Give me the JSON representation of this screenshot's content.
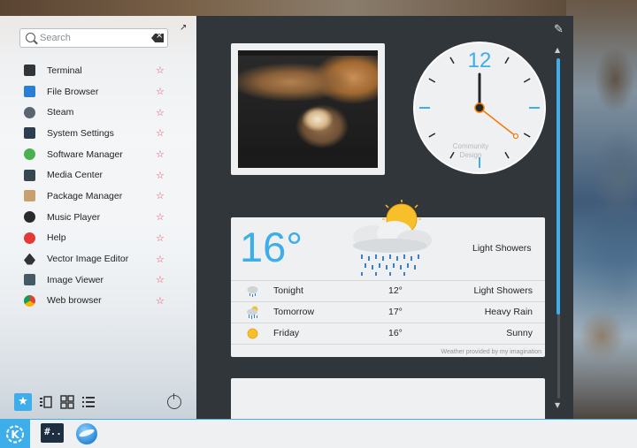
{
  "launcher": {
    "search_placeholder": "Search",
    "apps": [
      {
        "label": "Terminal",
        "icon": "terminal-icon",
        "color": "#31363b"
      },
      {
        "label": "File Browser",
        "icon": "folder-icon",
        "color": "#2a7fd4"
      },
      {
        "label": "Steam",
        "icon": "steam-icon",
        "color": "#5b6570"
      },
      {
        "label": "System Settings",
        "icon": "settings-icon",
        "color": "#2c3e50"
      },
      {
        "label": "Software Manager",
        "icon": "software-icon",
        "color": "#4caf50"
      },
      {
        "label": "Media Center",
        "icon": "media-icon",
        "color": "#37474f"
      },
      {
        "label": "Package Manager",
        "icon": "package-icon",
        "color": "#c8a070"
      },
      {
        "label": "Music Player",
        "icon": "music-icon",
        "color": "#2a2a2a"
      },
      {
        "label": "Help",
        "icon": "help-icon",
        "color": "#e53935"
      },
      {
        "label": "Vector Image Editor",
        "icon": "vector-editor-icon",
        "color": "#333333"
      },
      {
        "label": "Image Viewer",
        "icon": "image-viewer-icon",
        "color": "#455a64"
      },
      {
        "label": "Web browser",
        "icon": "chrome-icon",
        "color": "#db4437"
      }
    ]
  },
  "clock": {
    "twelve": "12",
    "watermark_line1": "Community",
    "watermark_line2": "Design",
    "hour_hand_hour": 12,
    "minute_hand_minute": 0,
    "second_hand_second": 18
  },
  "weather": {
    "current_temp": "16°",
    "current_condition": "Light Showers",
    "forecast": [
      {
        "day": "Tonight",
        "temp": "12°",
        "condition": "Light Showers",
        "icon": "rain-icon"
      },
      {
        "day": "Tomorrow",
        "temp": "17°",
        "condition": "Heavy Rain",
        "icon": "heavy-rain-icon"
      },
      {
        "day": "Friday",
        "temp": "16°",
        "condition": "Sunny",
        "icon": "sun-icon"
      }
    ],
    "credit": "Weather provided by my imagination"
  },
  "taskbar": {
    "terminal_glyph": "#.."
  },
  "colors": {
    "accent": "#3daee9",
    "dashboard_bg": "#31363b",
    "card_bg": "#eff0f1",
    "star": "#e0485a"
  }
}
